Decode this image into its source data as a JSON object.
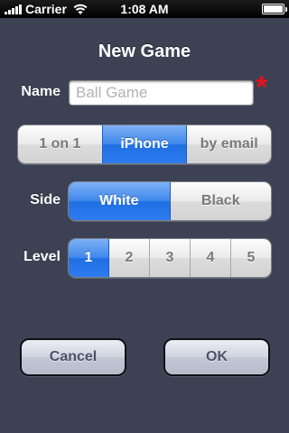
{
  "status_bar": {
    "carrier": "Carrier",
    "time": "1:08 AM",
    "icons": [
      "signal-bars-icon",
      "wifi-icon",
      "battery-icon"
    ]
  },
  "title": "New Game",
  "name_field": {
    "label": "Name",
    "value": "",
    "placeholder": "Ball Game",
    "required_mark": "*"
  },
  "mode": {
    "options": [
      "1 on 1",
      "iPhone",
      "by email"
    ],
    "selected": "iPhone"
  },
  "side": {
    "label": "Side",
    "options": [
      "White",
      "Black"
    ],
    "selected": "White"
  },
  "level": {
    "label": "Level",
    "options": [
      "1",
      "2",
      "3",
      "4",
      "5"
    ],
    "selected": "1"
  },
  "buttons": {
    "cancel": "Cancel",
    "ok": "OK"
  },
  "colors": {
    "background": "#3c4254",
    "selected_segment": "#2d7df0",
    "required": "#e0141e"
  }
}
